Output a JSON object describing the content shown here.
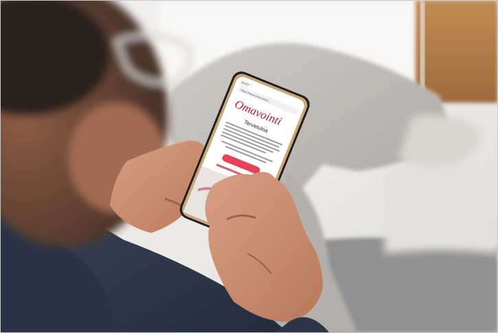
{
  "phone": {
    "status_time": "15:07",
    "url": "https://www.omavointi.fi/...",
    "logo_text": "Omavointi",
    "heading": "Tervetuloa",
    "button_label": "",
    "link_label": ""
  },
  "colors": {
    "brand_red": "#c8102e",
    "shirt": "#2e3a4f",
    "pants": "#b9b6b1",
    "skin": "#c98a6a",
    "background_wood": "#b88250"
  }
}
